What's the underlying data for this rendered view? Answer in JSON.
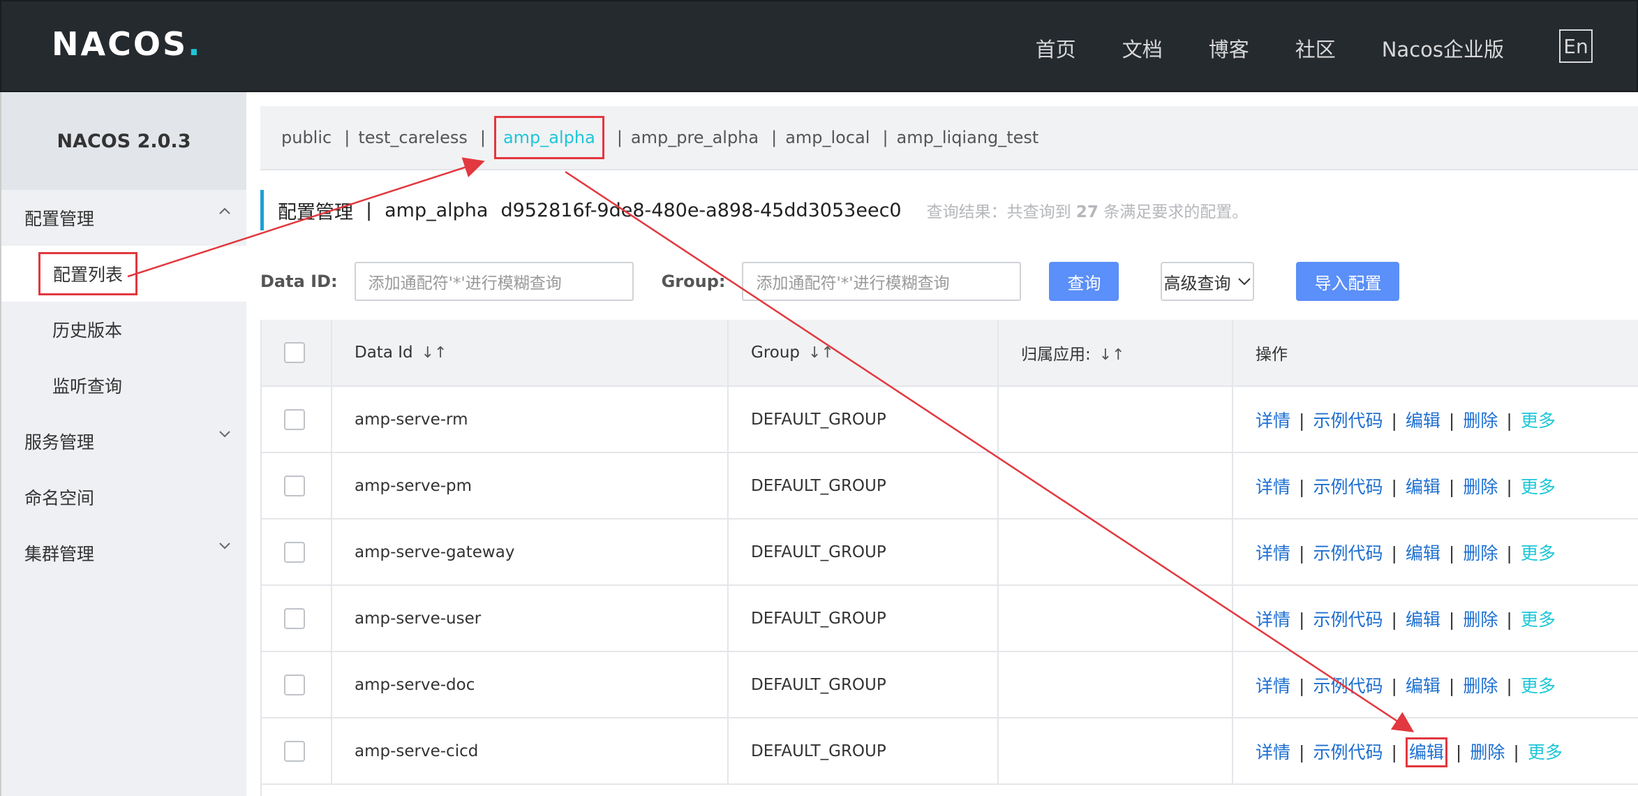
{
  "header": {
    "logo": "NACOS",
    "logo_dot": ".",
    "nav": [
      "首页",
      "文档",
      "博客",
      "社区",
      "Nacos企业版"
    ],
    "lang_button": "En"
  },
  "sidebar": {
    "version": "NACOS 2.0.3",
    "menus": [
      {
        "label": "配置管理"
      },
      {
        "label": "配置列表"
      },
      {
        "label": "历史版本"
      },
      {
        "label": "监听查询"
      },
      {
        "label": "服务管理"
      },
      {
        "label": "命名空间"
      },
      {
        "label": "集群管理"
      }
    ]
  },
  "namespaces": [
    "public",
    "test_careless",
    "amp_alpha",
    "amp_pre_alpha",
    "amp_local",
    "amp_liqiang_test"
  ],
  "separator": "|",
  "title": {
    "section": "配置管理",
    "separator": "|",
    "namespace": "amp_alpha",
    "namespace_id": "d952816f-9de8-480e-a898-45dd3053eec0",
    "result_prefix": "查询结果：共查询到",
    "result_count": "27",
    "result_suffix": "条满足要求的配置。"
  },
  "filter": {
    "data_id_label": "Data ID:",
    "data_id_placeholder": "添加通配符'*'进行模糊查询",
    "group_label": "Group:",
    "group_placeholder": "添加通配符'*'进行模糊查询",
    "query_button": "查询",
    "advanced_button": "高级查询",
    "import_button": "导入配置"
  },
  "table": {
    "headers": {
      "data_id": "Data Id",
      "group": "Group",
      "app": "归属应用:",
      "ops": "操作"
    },
    "ops": {
      "detail": "详情",
      "sample": "示例代码",
      "edit": "编辑",
      "delete": "删除",
      "more": "更多"
    },
    "rows": [
      {
        "data_id": "amp-serve-rm",
        "group": "DEFAULT_GROUP",
        "app": ""
      },
      {
        "data_id": "amp-serve-pm",
        "group": "DEFAULT_GROUP",
        "app": ""
      },
      {
        "data_id": "amp-serve-gateway",
        "group": "DEFAULT_GROUP",
        "app": ""
      },
      {
        "data_id": "amp-serve-user",
        "group": "DEFAULT_GROUP",
        "app": ""
      },
      {
        "data_id": "amp-serve-doc",
        "group": "DEFAULT_GROUP",
        "app": ""
      },
      {
        "data_id": "amp-serve-cicd",
        "group": "DEFAULT_GROUP",
        "app": ""
      }
    ]
  },
  "colors": {
    "header_bg": "#252a2f",
    "accent_cyan": "#1ec6d6",
    "primary_button": "#5b8ff9",
    "link_blue": "#1d6fd1",
    "annotation_red": "#e2383f"
  }
}
